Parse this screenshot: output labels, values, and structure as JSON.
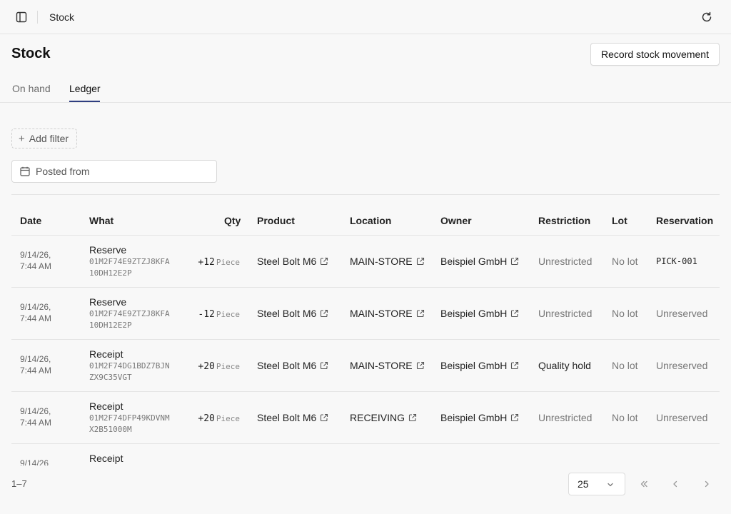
{
  "topbar": {
    "title": "Stock"
  },
  "page": {
    "title": "Stock",
    "record_button": "Record stock movement"
  },
  "tabs": [
    {
      "label": "On hand"
    },
    {
      "label": "Ledger"
    }
  ],
  "filters": {
    "add_filter": "Add filter",
    "posted_from_placeholder": "Posted from"
  },
  "table": {
    "headers": {
      "date": "Date",
      "what": "What",
      "qty": "Qty",
      "product": "Product",
      "location": "Location",
      "owner": "Owner",
      "restriction": "Restriction",
      "lot": "Lot",
      "reservation": "Reservation"
    },
    "rows": [
      {
        "date": "9/14/26, 7:44 AM",
        "what": "Reserve",
        "id": "01M2F74E9ZTZJ8KFA10DH12E2P",
        "qty": "+12",
        "unit": "Piece",
        "product": "Steel Bolt M6",
        "location": "MAIN-STORE",
        "owner": "Beispiel GmbH",
        "restriction": "Unrestricted",
        "lot": "No lot",
        "reservation": "PICK-001"
      },
      {
        "date": "9/14/26, 7:44 AM",
        "what": "Reserve",
        "id": "01M2F74E9ZTZJ8KFA10DH12E2P",
        "qty": "-12",
        "unit": "Piece",
        "product": "Steel Bolt M6",
        "location": "MAIN-STORE",
        "owner": "Beispiel GmbH",
        "restriction": "Unrestricted",
        "lot": "No lot",
        "reservation": "Unreserved"
      },
      {
        "date": "9/14/26, 7:44 AM",
        "what": "Receipt",
        "id": "01M2F74DG1BDZ7BJNZX9C35VGT",
        "qty": "+20",
        "unit": "Piece",
        "product": "Steel Bolt M6",
        "location": "MAIN-STORE",
        "owner": "Beispiel GmbH",
        "restriction": "Quality hold",
        "lot": "No lot",
        "reservation": "Unreserved"
      },
      {
        "date": "9/14/26, 7:44 AM",
        "what": "Receipt",
        "id": "01M2F74DFP49KDVNMX2B51000M",
        "qty": "+20",
        "unit": "Piece",
        "product": "Steel Bolt M6",
        "location": "RECEIVING",
        "owner": "Beispiel GmbH",
        "restriction": "Unrestricted",
        "lot": "No lot",
        "reservation": "Unreserved"
      },
      {
        "date": "9/14/26",
        "what": "Receipt"
      }
    ]
  },
  "pagination": {
    "range": "1–7",
    "page_size": "25"
  }
}
